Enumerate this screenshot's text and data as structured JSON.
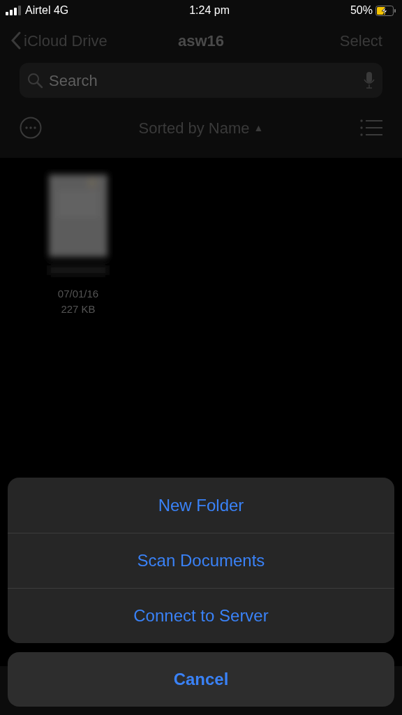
{
  "status_bar": {
    "carrier": "Airtel 4G",
    "time": "1:24 pm",
    "battery": "50%"
  },
  "nav": {
    "back": "iCloud Drive",
    "title": "asw16",
    "action": "Select"
  },
  "search": {
    "placeholder": "Search"
  },
  "sort": {
    "label": "Sorted by Name",
    "arrow": "▲"
  },
  "files": [
    {
      "kind": "picture",
      "date": "07/01/16",
      "size": "227 KB"
    }
  ],
  "action_sheet": {
    "actions": [
      {
        "label": "New Folder"
      },
      {
        "label": "Scan Documents"
      },
      {
        "label": "Connect to Server"
      }
    ],
    "cancel": "Cancel"
  }
}
